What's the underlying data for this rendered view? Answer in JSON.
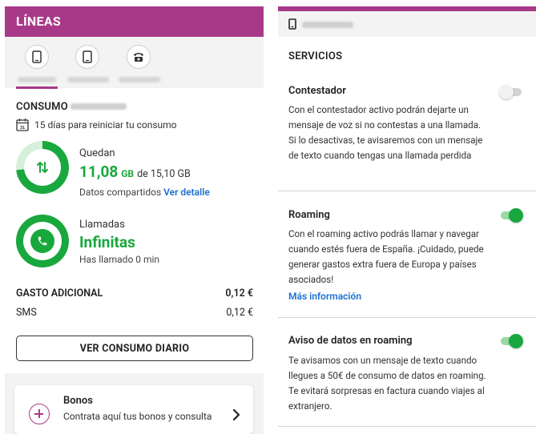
{
  "left": {
    "header_title": "LÍNEAS",
    "tabs": [
      {
        "icon": "mobile-phone-icon"
      },
      {
        "icon": "mobile-phone-icon"
      },
      {
        "icon": "landline-phone-icon"
      }
    ],
    "consumo_label": "CONSUMO",
    "reset_text": "15 días para reiniciar tu consumo",
    "data": {
      "label": "Quedan",
      "amount": "11,08",
      "unit": "GB",
      "of_text": "de 15,10 GB",
      "remaining_fraction": 0.734,
      "shared_text": "Datos compartidos",
      "detail_link": "Ver detalle",
      "color": "#19a83d"
    },
    "calls": {
      "label": "Llamadas",
      "value": "Infinitas",
      "called_text": "Has llamado 0 min"
    },
    "extra": {
      "title": "GASTO ADICIONAL",
      "total": "0,12 €",
      "sms_label": "SMS",
      "sms_value": "0,12 €"
    },
    "daily_button": "VER CONSUMO DIARIO",
    "bonos": {
      "title": "Bonos",
      "subtitle": "Contrata aquí tus bonos y consulta"
    }
  },
  "right": {
    "section_title": "SERVICIOS",
    "services": [
      {
        "title": "Contestador",
        "description": "Con el contestador activo podrán dejarte un mensaje de voz si no contestas a una llamada. Si lo desactivas, te avisaremos con un mensaje de texto cuando tengas una llamada perdida",
        "enabled": false
      },
      {
        "title": "Roaming",
        "description": "Con el roaming activo podrás llamar y navegar cuando estés fuera de España. ¡Cuidado, puede generar gastos extra fuera de Europa y países asociados!",
        "link": "Más información",
        "enabled": true
      },
      {
        "title": "Aviso de datos en roaming",
        "description": "Te avisamos con un mensaje de texto cuando llegues a 50€ de consumo de datos en roaming. Te evitará sorpresas en factura cuando viajes al extranjero.",
        "enabled": true
      }
    ]
  },
  "colors": {
    "brand": "#a73988",
    "accent_green": "#19a83d",
    "link_blue": "#1b6fd1"
  }
}
